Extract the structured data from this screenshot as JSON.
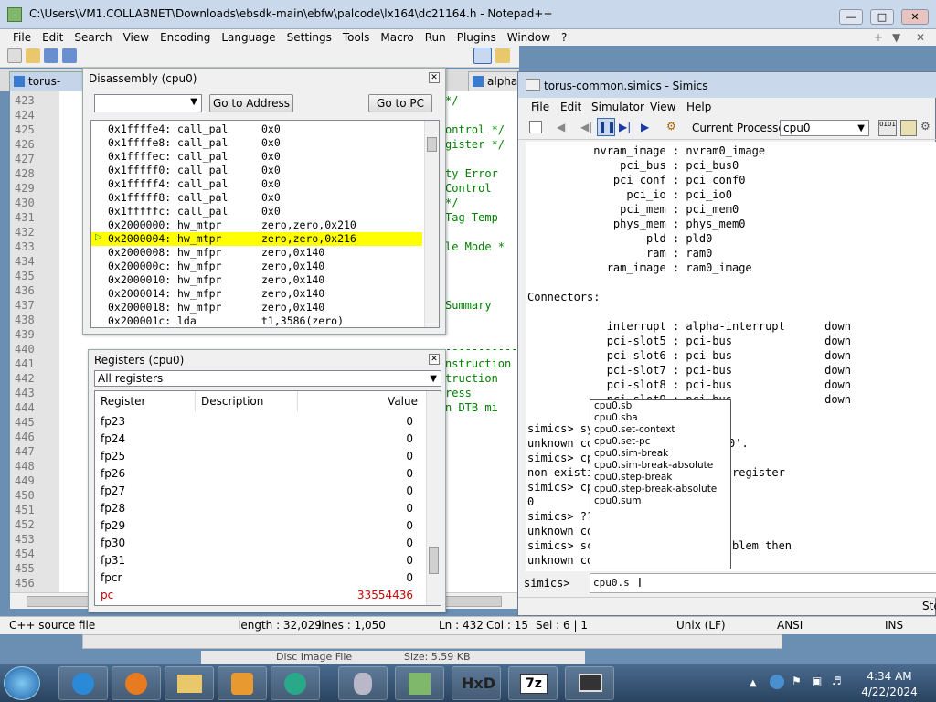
{
  "npp": {
    "title": "C:\\Users\\VM1.COLLABNET\\Downloads\\ebsdk-main\\ebfw\\palcode\\lx164\\dc21164.h - Notepad++",
    "menu": [
      "File",
      "Edit",
      "Search",
      "View",
      "Encoding",
      "Language",
      "Settings",
      "Tools",
      "Macro",
      "Run",
      "Plugins",
      "Window",
      "?"
    ],
    "tabs": [
      "torus-setup",
      "alpha"
    ],
    "line_numbers": [
      "423",
      "424",
      "425",
      "426",
      "427",
      "428",
      "429",
      "430",
      "431",
      "432",
      "433",
      "434",
      "435",
      "436",
      "437",
      "438",
      "439",
      "440",
      "441",
      "442",
      "443",
      "444",
      "445",
      "446",
      "447",
      "448",
      "449",
      "450",
      "451",
      "452",
      "453",
      "454",
      "455",
      "456"
    ],
    "code_fragments": [
      {
        "t": "*/",
        "row": 0
      },
      {
        "t": "ontrol */",
        "row": 2
      },
      {
        "t": "gister */",
        "row": 3
      },
      {
        "t": "ty Error",
        "row": 5
      },
      {
        "t": "Control",
        "row": 6
      },
      {
        "t": "*/",
        "row": 7
      },
      {
        "t": "Tag Temp",
        "row": 8
      },
      {
        "t": "le Mode *",
        "row": 10
      },
      {
        "t": "Summary",
        "row": 14
      },
      {
        "t": "-----------",
        "row": 17
      },
      {
        "t": "nstruction",
        "row": 18
      },
      {
        "t": "truction",
        "row": 19
      },
      {
        "t": "ress",
        "row": 20
      },
      {
        "t": "n DTB mi",
        "row": 21
      }
    ],
    "status": {
      "filetype": "C++ source file",
      "length": "length : 32,029",
      "lines": "lines : 1,050",
      "pos": "Ln : 432",
      "col": "Col : 15",
      "sel": "Sel : 6 | 1",
      "eol": "Unix (LF)",
      "enc": "ANSI",
      "ins": "INS"
    }
  },
  "disasm": {
    "title": "Disassembly (cpu0)",
    "goto_address": "Go to Address",
    "goto_pc": "Go to PC",
    "rows": [
      {
        "addr": "0x1ffffe4:",
        "op": "call_pal",
        "args": "0x0",
        "hl": false
      },
      {
        "addr": "0x1ffffe8:",
        "op": "call_pal",
        "args": "0x0",
        "hl": false
      },
      {
        "addr": "0x1ffffec:",
        "op": "call_pal",
        "args": "0x0",
        "hl": false
      },
      {
        "addr": "0x1fffff0:",
        "op": "call_pal",
        "args": "0x0",
        "hl": false
      },
      {
        "addr": "0x1fffff4:",
        "op": "call_pal",
        "args": "0x0",
        "hl": false
      },
      {
        "addr": "0x1fffff8:",
        "op": "call_pal",
        "args": "0x0",
        "hl": false
      },
      {
        "addr": "0x1fffffc:",
        "op": "call_pal",
        "args": "0x0",
        "hl": false
      },
      {
        "addr": "0x2000000:",
        "op": "hw_mtpr ",
        "args": "zero,zero,0x210",
        "hl": false
      },
      {
        "addr": "0x2000004:",
        "op": "hw_mtpr ",
        "args": "zero,zero,0x216",
        "hl": true
      },
      {
        "addr": "0x2000008:",
        "op": "hw_mfpr ",
        "args": "zero,0x140",
        "hl": false
      },
      {
        "addr": "0x200000c:",
        "op": "hw_mfpr ",
        "args": "zero,0x140",
        "hl": false
      },
      {
        "addr": "0x2000010:",
        "op": "hw_mfpr ",
        "args": "zero,0x140",
        "hl": false
      },
      {
        "addr": "0x2000014:",
        "op": "hw_mfpr ",
        "args": "zero,0x140",
        "hl": false
      },
      {
        "addr": "0x2000018:",
        "op": "hw_mfpr ",
        "args": "zero,0x140",
        "hl": false
      },
      {
        "addr": "0x200001c:",
        "op": "lda     ",
        "args": "t1,3586(zero)",
        "hl": false
      }
    ]
  },
  "registers": {
    "title": "Registers (cpu0)",
    "filter": "All registers",
    "headers": {
      "register": "Register",
      "description": "Description",
      "value": "Value"
    },
    "rows": [
      {
        "name": "fp23",
        "value": "0"
      },
      {
        "name": "fp24",
        "value": "0"
      },
      {
        "name": "fp25",
        "value": "0"
      },
      {
        "name": "fp26",
        "value": "0"
      },
      {
        "name": "fp27",
        "value": "0"
      },
      {
        "name": "fp28",
        "value": "0"
      },
      {
        "name": "fp29",
        "value": "0"
      },
      {
        "name": "fp30",
        "value": "0"
      },
      {
        "name": "fp31",
        "value": "0"
      },
      {
        "name": "fpcr",
        "value": "0"
      },
      {
        "name": "pc",
        "value": "33554436"
      }
    ],
    "changed_color": "#cc0000"
  },
  "simics": {
    "title": "torus-common.simics - Simics",
    "menu": [
      "File",
      "Edit",
      "Simulator",
      "View",
      "Help"
    ],
    "processor_label": "Current Processor:",
    "processor": "cpu0",
    "console": [
      "          nvram_image : nvram0_image",
      "              pci_bus : pci_bus0",
      "             pci_conf : pci_conf0",
      "               pci_io : pci_io0",
      "              pci_mem : pci_mem0",
      "             phys_mem : phys_mem0",
      "                  pld : pld0",
      "                  ram : ram0",
      "            ram_image : ram0_image",
      "",
      "Connectors:",
      "",
      "            interrupt : alpha-interrupt      down",
      "            pci-slot5 : pci-bus              down",
      "            pci-slot6 : pci-bus              down",
      "            pci-slot7 : pci-bus              down",
      "            pci-slot8 : pci-bus              down",
      "            pci-slot9 : pci-bus              down",
      "",
      "simics> sy",
      "unknown co",
      "simics> cp",
      "non-existi",
      "simics> cp",
      "0",
      "simics> ??",
      "unknown co",
      "simics> sc",
      "unknown co"
    ],
    "hidden_tails": [
      {
        "row": 20,
        "t": "0'."
      },
      {
        "row": 22,
        "t": "register"
      },
      {
        "row": 27,
        "t": "blem then"
      }
    ],
    "prompt": "simics>",
    "input": "cpu0.s",
    "completions": [
      "cpu0.sb",
      "cpu0.sba",
      "cpu0.set-context",
      "cpu0.set-pc",
      "cpu0.sim-break",
      "cpu0.sim-break-absolute",
      "cpu0.step-break",
      "cpu0.step-break-absolute",
      "cpu0.sum"
    ],
    "status_right": "Ste"
  },
  "background_fragments": [
    "Disc Image File",
    "Size: 5.59 KB"
  ],
  "taskbar": {
    "time": "4:34 AM",
    "date": "4/22/2024",
    "apps": [
      "start-orb",
      "internet-explorer",
      "firefox",
      "file-explorer",
      "media-player",
      "app-5",
      "app-6",
      "notepad-plus-plus",
      "hxd",
      "7zip",
      "simics-vm"
    ]
  }
}
